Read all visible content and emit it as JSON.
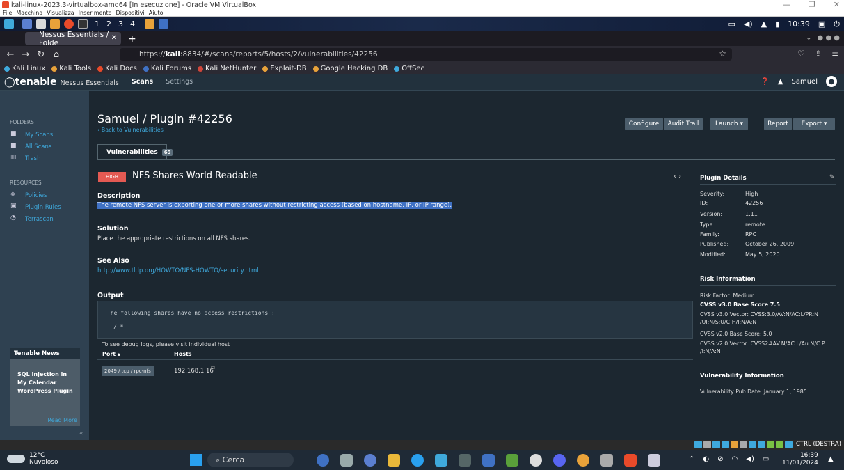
{
  "vbox": {
    "title": "kali-linux-2023.3-virtualbox-amd64 [In esecuzione] - Oracle VM VirtualBox",
    "menu": [
      "File",
      "Macchina",
      "Visualizza",
      "Inserimento",
      "Dispositivi",
      "Aiuto"
    ],
    "ctrl_label": "CTRL (DESTRA)"
  },
  "kali_panel": {
    "workspaces": [
      "1",
      "2",
      "3",
      "4"
    ],
    "time": "10:39"
  },
  "firefox": {
    "tab_title": "Nessus Essentials / Folde",
    "url_prefix": "https://",
    "url_host": "kali",
    "url_rest": ":8834/#/scans/reports/5/hosts/2/vulnerabilities/42256",
    "bookmarks": [
      {
        "label": "Kali Linux",
        "color": "#3fa9dc"
      },
      {
        "label": "Kali Tools",
        "color": "#e8a23a"
      },
      {
        "label": "Kali Docs",
        "color": "#e84a2a"
      },
      {
        "label": "Kali Forums",
        "color": "#3f71c4"
      },
      {
        "label": "Kali NetHunter",
        "color": "#d0463b"
      },
      {
        "label": "Exploit-DB",
        "color": "#e8a23a"
      },
      {
        "label": "Google Hacking DB",
        "color": "#e8a23a"
      },
      {
        "label": "OffSec",
        "color": "#3fa9dc"
      }
    ]
  },
  "nessus": {
    "logo": "tenable",
    "logo_sub": "Nessus Essentials",
    "nav": {
      "scans": "Scans",
      "settings": "Settings"
    },
    "user": "Samuel",
    "sidebar": {
      "folders_head": "FOLDERS",
      "folders": [
        "My Scans",
        "All Scans",
        "Trash"
      ],
      "resources_head": "RESOURCES",
      "resources": [
        "Policies",
        "Plugin Rules",
        "Terrascan"
      ],
      "news_head": "Tenable News",
      "news_title": "SQL Injection in My Calendar WordPress Plugin",
      "news_more": "Read More",
      "collapse": "«"
    },
    "page_title": "Samuel / Plugin #42256",
    "back_link": "‹ Back to Vulnerabilities",
    "buttons": {
      "configure": "Configure",
      "audit": "Audit Trail",
      "launch": "Launch ▾",
      "report": "Report",
      "export": "Export ▾"
    },
    "tab": {
      "label": "Vulnerabilities",
      "count": "69"
    },
    "severity": "HIGH",
    "vuln_name": "NFS Shares World Readable",
    "nav_arrows": "‹  ›",
    "description_head": "Description",
    "description": "The remote NFS server is exporting one or more shares without restricting access (based on hostname, IP, or IP range).",
    "solution_head": "Solution",
    "solution": "Place the appropriate restrictions on all NFS shares.",
    "see_also_head": "See Also",
    "see_also": "http://www.tldp.org/HOWTO/NFS-HOWTO/security.html",
    "output_head": "Output",
    "output_line1": "The following shares have no access restrictions :",
    "output_line2": "/ *",
    "debug": "To see debug logs, please visit individual host",
    "col_port": "Port ▴",
    "col_hosts": "Hosts",
    "port": "2049 / tcp / rpc-nfs",
    "host": "192.168.1.16",
    "plugin_details_head": "Plugin Details",
    "details": [
      {
        "k": "Severity:",
        "v": "High"
      },
      {
        "k": "ID:",
        "v": "42256"
      },
      {
        "k": "Version:",
        "v": "1.11"
      },
      {
        "k": "Type:",
        "v": "remote"
      },
      {
        "k": "Family:",
        "v": "RPC"
      },
      {
        "k": "Published:",
        "v": "October 26, 2009"
      },
      {
        "k": "Modified:",
        "v": "May 5, 2020"
      }
    ],
    "risk_head": "Risk Information",
    "risk_factor": "Risk Factor: Medium",
    "cvss3_score": "CVSS v3.0 Base Score 7.5",
    "cvss3_vector": "CVSS v3.0 Vector: CVSS:3.0/AV:N/AC:L/PR:N /UI:N/S:U/C:H/I:N/A:N",
    "cvss2_score": "CVSS v2.0 Base Score: 5.0",
    "cvss2_vector": "CVSS v2.0 Vector: CVSS2#AV:N/AC:L/Au:N/C:P /I:N/A:N",
    "vinfo_head": "Vulnerability Information",
    "vinfo_date": "Vulnerability Pub Date: January 1, 1985"
  },
  "taskbar": {
    "temp": "12°C",
    "weather": "Nuvoloso",
    "search": "Cerca",
    "time": "16:39",
    "date": "11/01/2024"
  }
}
